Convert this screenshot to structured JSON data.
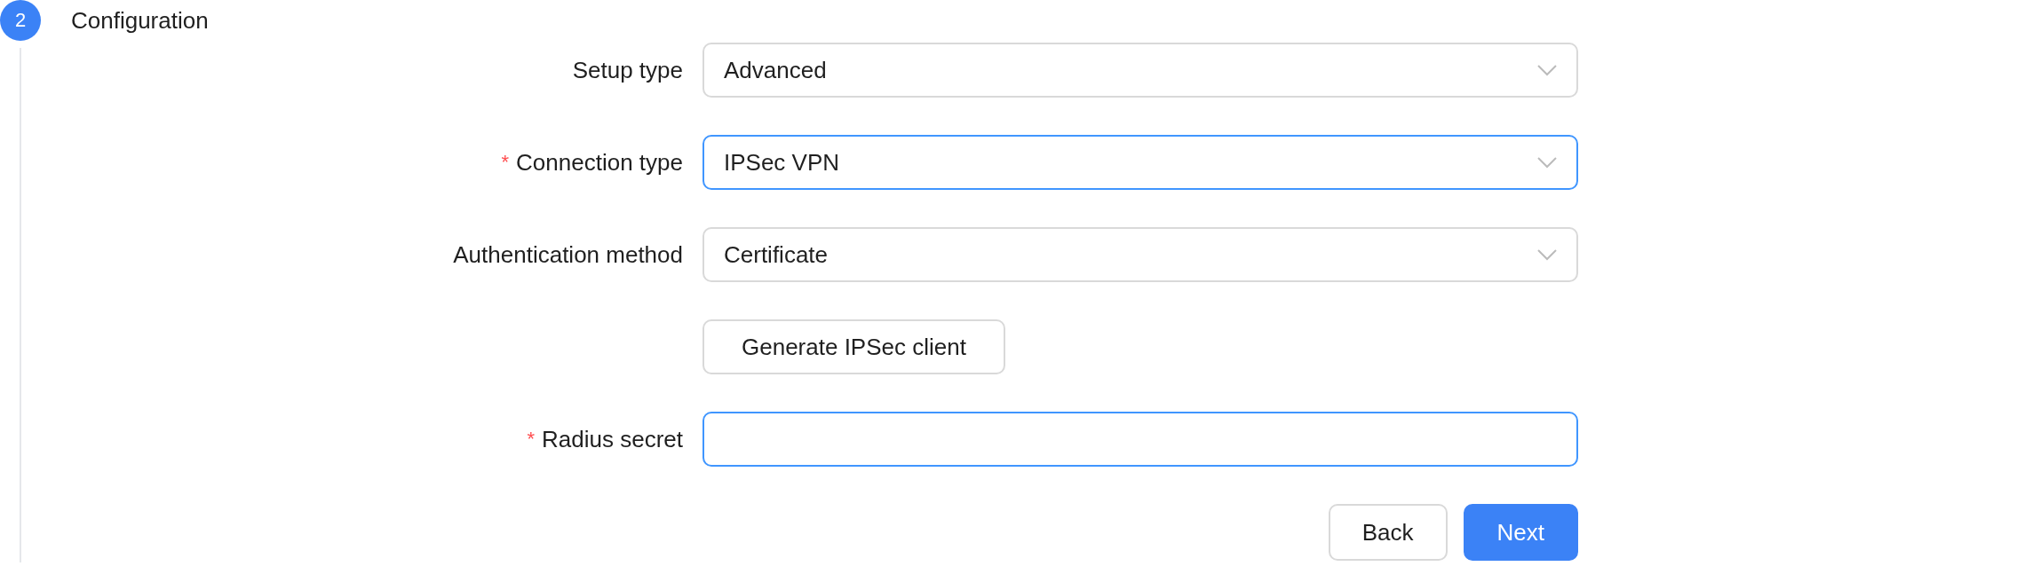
{
  "step": {
    "number": "2",
    "title": "Configuration",
    "active": true
  },
  "fields": [
    {
      "kind": "select",
      "label": "Setup type",
      "required": false,
      "value": "Advanced",
      "focused": false
    },
    {
      "kind": "select",
      "label": "Connection type",
      "required": true,
      "value": "IPSec VPN",
      "focused": true
    },
    {
      "kind": "select",
      "label": "Authentication method",
      "required": false,
      "value": "Certificate",
      "focused": false
    },
    {
      "kind": "button",
      "label": "Generate IPSec client"
    },
    {
      "kind": "input",
      "label": "Radius secret",
      "required": true,
      "focused": true
    }
  ],
  "required_mark": "*",
  "buttons": [
    {
      "label": "Back",
      "primary": false
    },
    {
      "label": "Next",
      "primary": true
    }
  ]
}
